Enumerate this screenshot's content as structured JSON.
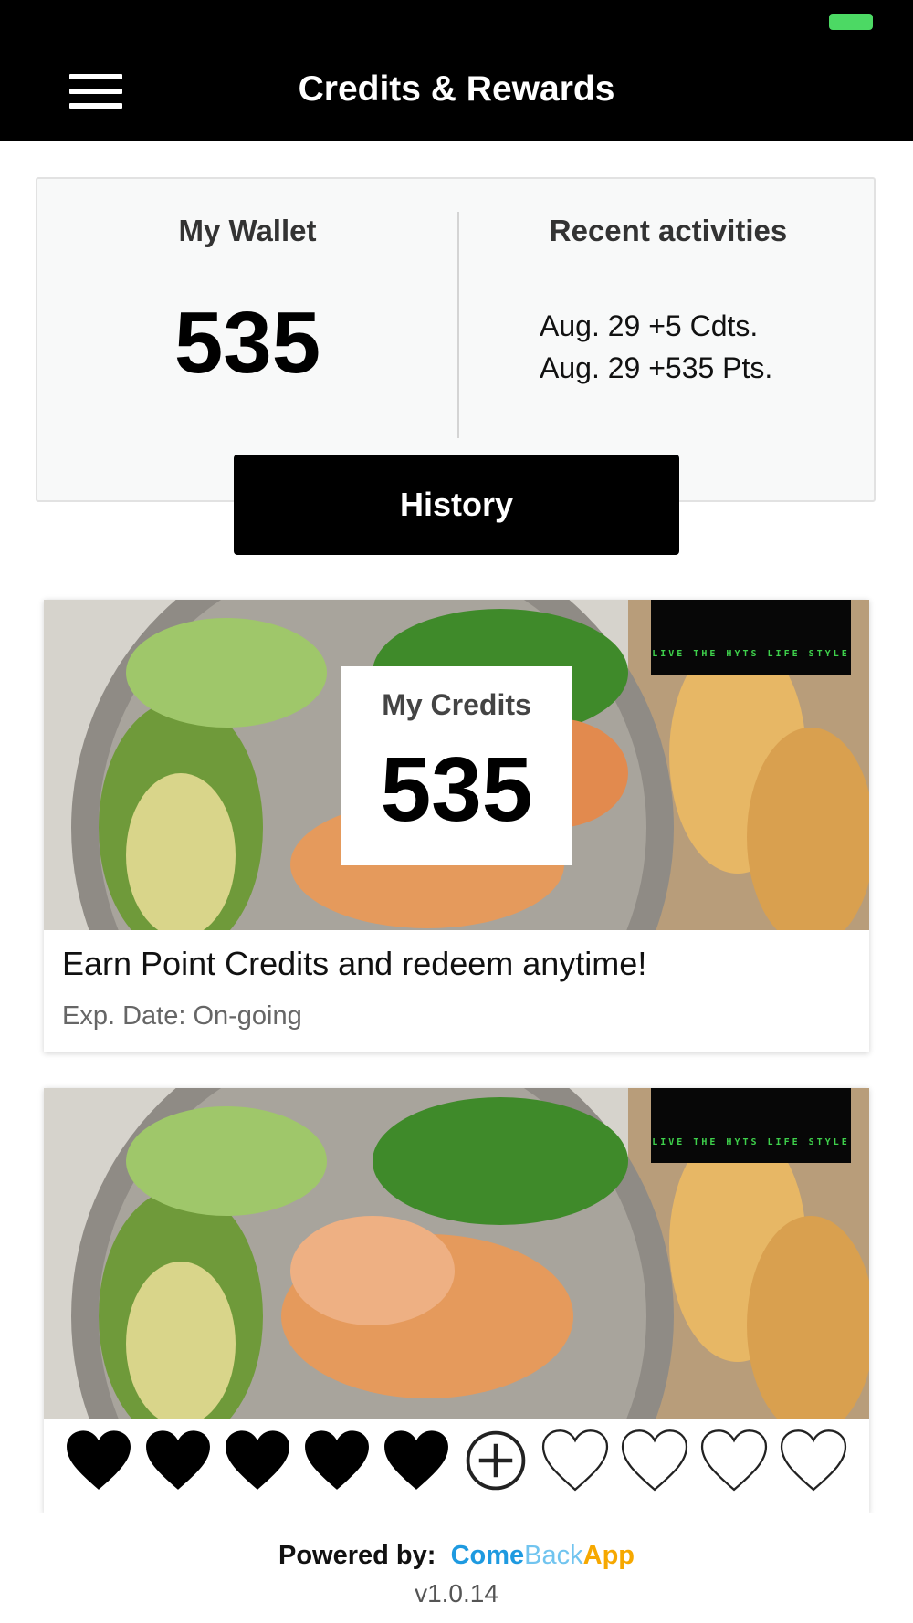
{
  "header": {
    "title": "Credits & Rewards",
    "menu_icon": "hamburger-menu-icon"
  },
  "wallet": {
    "title": "My Wallet",
    "amount": "535",
    "recent_title": "Recent activities",
    "recent_items": [
      "Aug. 29 +5 Cdts.",
      "Aug. 29 +535 Pts."
    ],
    "history_label": "History"
  },
  "promos": [
    {
      "credits_label": "My Credits",
      "credits_value": "535",
      "logo_text": "LIVE THE HYTS LIFE STYLE",
      "text": "Earn Point Credits and redeem anytime!",
      "exp": "Exp. Date: On-going"
    },
    {
      "logo_text": "LIVE THE HYTS LIFE STYLE",
      "stamps_filled": 5,
      "stamps_total": 10,
      "stamp_icons": [
        "heart-filled-icon",
        "heart-filled-icon",
        "heart-filled-icon",
        "heart-filled-icon",
        "heart-filled-icon",
        "plus-circle-icon",
        "heart-outline-icon",
        "heart-outline-icon",
        "heart-outline-icon",
        "heart-outline-icon"
      ]
    }
  ],
  "footer": {
    "powered_by": "Powered by:",
    "brand_come": "Come",
    "brand_back": "Back",
    "brand_app": "App",
    "version": "v1.0.14"
  },
  "colors": {
    "header_bg": "#000000",
    "battery": "#4cd964",
    "brand_come": "#1e9ae0",
    "brand_back": "#71c4ef",
    "brand_app": "#f6a800",
    "logo_green": "#3ed04b"
  }
}
